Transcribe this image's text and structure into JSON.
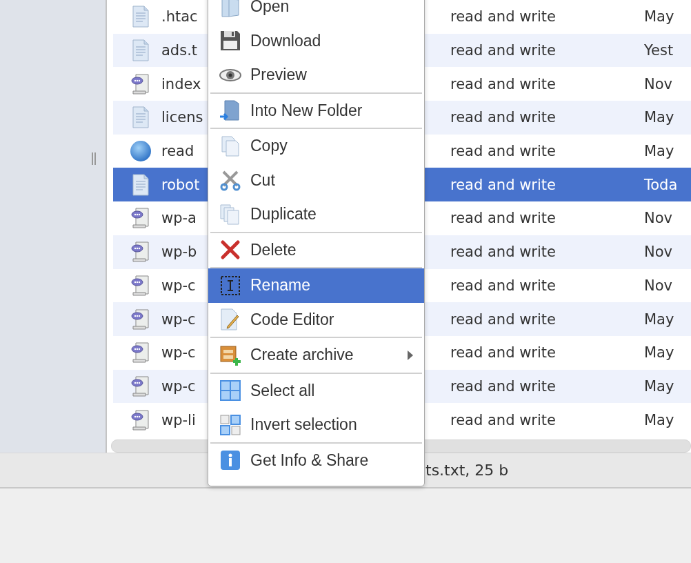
{
  "files": [
    {
      "name": ".htac",
      "kind": "text",
      "permissions": "read and write",
      "modified": "May",
      "selected": false
    },
    {
      "name": "ads.t",
      "kind": "text",
      "permissions": "read and write",
      "modified": "Yest",
      "selected": false
    },
    {
      "name": "index",
      "kind": "script",
      "permissions": "read and write",
      "modified": "Nov",
      "selected": false
    },
    {
      "name": "licens",
      "kind": "text",
      "permissions": "read and write",
      "modified": "May",
      "selected": false
    },
    {
      "name": "read",
      "kind": "web",
      "permissions": "read and write",
      "modified": "May",
      "selected": false
    },
    {
      "name": "robot",
      "kind": "text",
      "permissions": "read and write",
      "modified": "Toda",
      "selected": true
    },
    {
      "name": "wp-a",
      "kind": "script",
      "permissions": "read and write",
      "modified": "Nov",
      "selected": false
    },
    {
      "name": "wp-b",
      "kind": "script",
      "permissions": "read and write",
      "modified": "Nov",
      "selected": false
    },
    {
      "name": "wp-c",
      "kind": "script",
      "permissions": "read and write",
      "modified": "Nov",
      "selected": false
    },
    {
      "name": "wp-c",
      "kind": "script",
      "permissions": "read and write",
      "modified": "May",
      "selected": false
    },
    {
      "name": "wp-c",
      "kind": "script",
      "permissions": "read and write",
      "modified": "May",
      "selected": false
    },
    {
      "name": "wp-c",
      "kind": "script",
      "permissions": "read and write",
      "modified": "May",
      "selected": false
    },
    {
      "name": "wp-li",
      "kind": "script",
      "permissions": "read and write",
      "modified": "May",
      "selected": false
    }
  ],
  "context_menu": {
    "groups": [
      [
        {
          "label": "Open",
          "selected": false,
          "submenu": false
        },
        {
          "label": "Download",
          "selected": false,
          "submenu": false
        },
        {
          "label": "Preview",
          "selected": false,
          "submenu": false
        }
      ],
      [
        {
          "label": "Into New Folder",
          "selected": false,
          "submenu": false
        }
      ],
      [
        {
          "label": "Copy",
          "selected": false,
          "submenu": false
        },
        {
          "label": "Cut",
          "selected": false,
          "submenu": false
        },
        {
          "label": "Duplicate",
          "selected": false,
          "submenu": false
        }
      ],
      [
        {
          "label": "Delete",
          "selected": false,
          "submenu": false
        }
      ],
      [
        {
          "label": "Rename",
          "selected": true,
          "submenu": false
        },
        {
          "label": "Code Editor",
          "selected": false,
          "submenu": false
        }
      ],
      [
        {
          "label": "Create archive",
          "selected": false,
          "submenu": true
        }
      ],
      [
        {
          "label": "Select all",
          "selected": false,
          "submenu": false
        },
        {
          "label": "Invert selection",
          "selected": false,
          "submenu": false
        }
      ],
      [
        {
          "label": "Get Info & Share",
          "selected": false,
          "submenu": false
        }
      ]
    ]
  },
  "status_bar": {
    "text": "ts.txt, 25 b"
  }
}
